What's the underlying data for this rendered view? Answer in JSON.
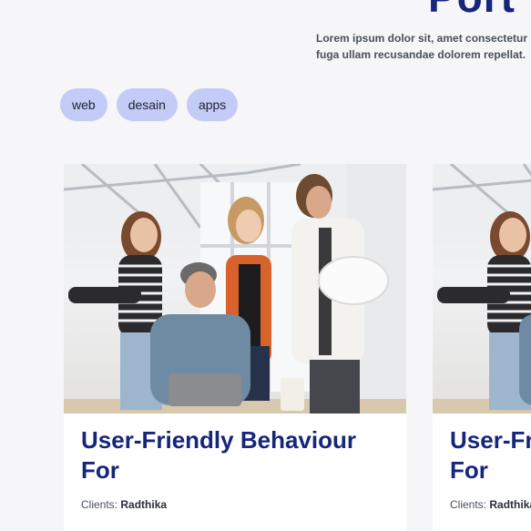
{
  "header": {
    "title_fragment": "Port",
    "intro_lines": [
      "Lorem ipsum dolor sit, amet consectetur",
      "fuga ullam recusandae dolorem repellat."
    ]
  },
  "filters": {
    "tags": [
      "web",
      "desain",
      "apps"
    ],
    "tag_color": "#c3cbf7"
  },
  "portfolio": {
    "cards": [
      {
        "title": "User-Friendly Behaviour For",
        "client_label": "Clients:",
        "client_name": "Radthika",
        "image": "team-meeting-photo"
      },
      {
        "title": "User-Friendly Behaviour For",
        "client_label": "Clients:",
        "client_name": "Radthika",
        "image": "team-meeting-photo"
      }
    ]
  },
  "colors": {
    "title": "#16267a",
    "background": "#f6f6f8",
    "card": "#ffffff"
  }
}
